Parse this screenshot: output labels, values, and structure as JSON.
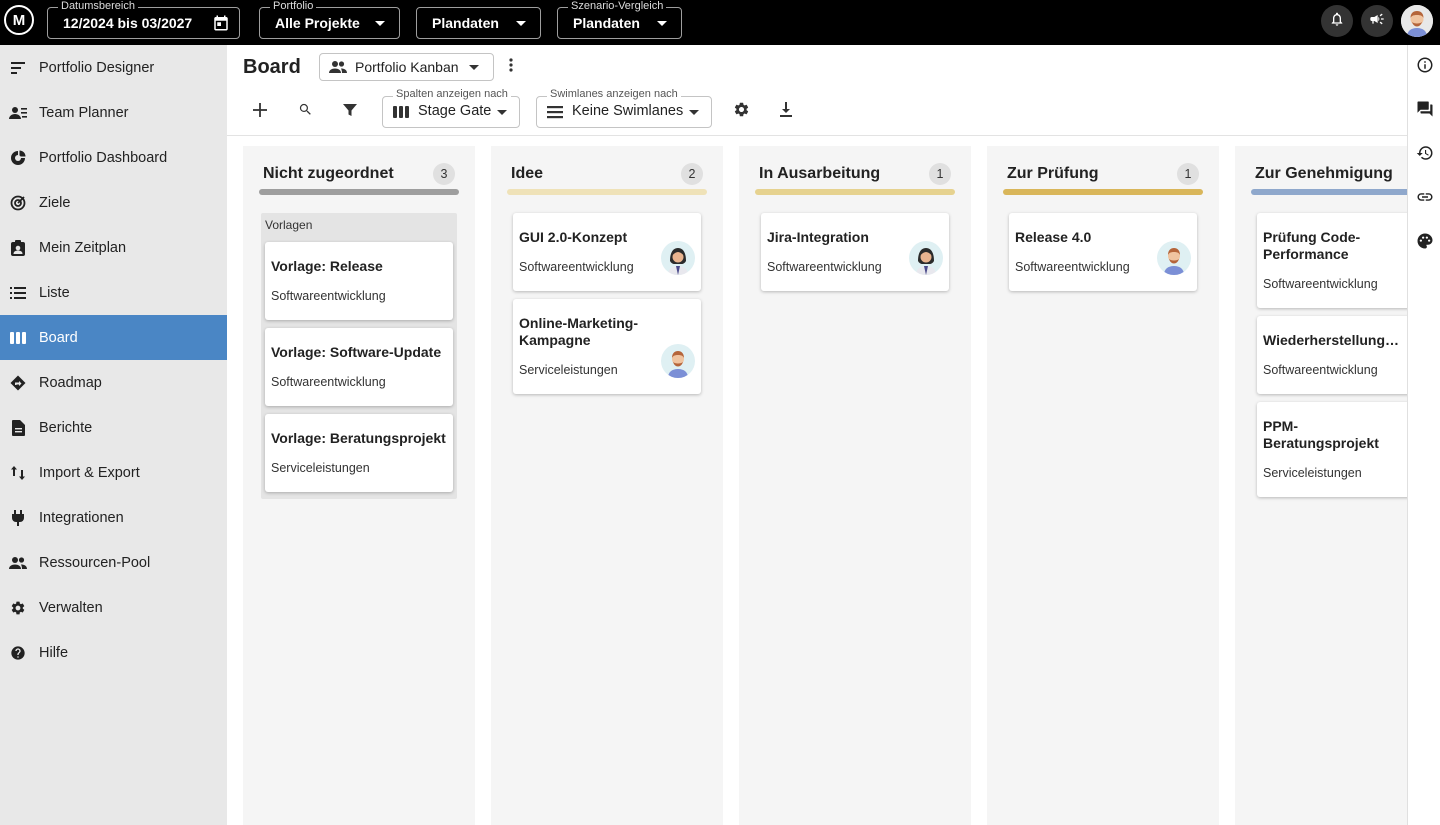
{
  "topbar": {
    "logo": "M",
    "date_range": {
      "label": "Datumsbereich",
      "value": "12/2024 bis 03/2027"
    },
    "portfolio": {
      "label": "Portfolio",
      "value": "Alle Projekte"
    },
    "dataset": {
      "value": "Plandaten"
    },
    "scenario": {
      "label": "Szenario-Vergleich",
      "value": "Plandaten"
    }
  },
  "sidebar": {
    "items": [
      {
        "label": "Portfolio Designer",
        "icon": "portfolio-designer-icon"
      },
      {
        "label": "Team Planner",
        "icon": "team-planner-icon"
      },
      {
        "label": "Portfolio Dashboard",
        "icon": "dashboard-icon"
      },
      {
        "label": "Ziele",
        "icon": "target-icon"
      },
      {
        "label": "Mein Zeitplan",
        "icon": "schedule-icon"
      },
      {
        "label": "Liste",
        "icon": "list-icon"
      },
      {
        "label": "Board",
        "icon": "board-icon",
        "active": true
      },
      {
        "label": "Roadmap",
        "icon": "roadmap-icon"
      },
      {
        "label": "Berichte",
        "icon": "report-icon"
      },
      {
        "label": "Import & Export",
        "icon": "import-export-icon"
      },
      {
        "label": "Integrationen",
        "icon": "plug-icon"
      },
      {
        "label": "Ressourcen-Pool",
        "icon": "people-icon"
      },
      {
        "label": "Verwalten",
        "icon": "gear-icon"
      },
      {
        "label": "Hilfe",
        "icon": "help-icon"
      }
    ]
  },
  "header": {
    "title": "Board",
    "view": "Portfolio Kanban",
    "columns_by": {
      "label": "Spalten anzeigen nach",
      "value": "Stage Gate"
    },
    "swimlanes_by": {
      "label": "Swimlanes anzeigen nach",
      "value": "Keine Swimlanes"
    }
  },
  "colors": {
    "accent": "#4a86c5",
    "bar_unassigned": "#9e9e9e",
    "bar_idea": "#efe2b8",
    "bar_in_progress": "#e6d28f",
    "bar_review": "#d9b65a",
    "bar_approval": "#8fa8cc"
  },
  "columns": [
    {
      "title": "Nicht zugeordnet",
      "count": "3",
      "group": "Vorlagen",
      "cards": [
        {
          "title": "Vorlage: Release",
          "sub": "Softwareentwicklung"
        },
        {
          "title": "Vorlage: Software-Update",
          "sub": "Softwareentwicklung"
        },
        {
          "title": "Vorlage: Beratungsprojekt",
          "sub": "Serviceleistungen"
        }
      ]
    },
    {
      "title": "Idee",
      "count": "2",
      "cards": [
        {
          "title": "GUI 2.0-Konzept",
          "sub": "Softwareentwicklung"
        },
        {
          "title": "Online-Marketing-Kampagne",
          "sub": "Serviceleistungen"
        }
      ]
    },
    {
      "title": "In Ausarbeitung",
      "count": "1",
      "cards": [
        {
          "title": "Jira-Integration",
          "sub": "Softwareentwicklung"
        }
      ]
    },
    {
      "title": "Zur Prüfung",
      "count": "1",
      "cards": [
        {
          "title": "Release 4.0",
          "sub": "Softwareentwicklung"
        }
      ]
    },
    {
      "title": "Zur Genehmigung",
      "cards": [
        {
          "title": "Prüfung Code-Performance",
          "sub": "Softwareentwicklung"
        },
        {
          "title": "Wiederherstellungs…",
          "sub": "Softwareentwicklung"
        },
        {
          "title": "PPM-Beratungsprojekt",
          "sub": "Serviceleistungen"
        }
      ]
    }
  ]
}
